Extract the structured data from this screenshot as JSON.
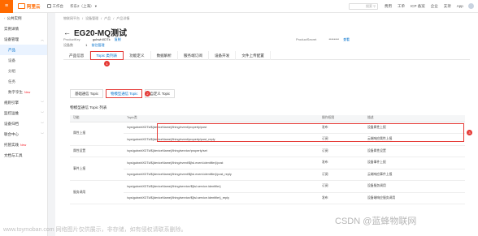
{
  "topbar": {
    "brand": "阿里云",
    "workbench": "工作台",
    "region": "华东2（上海）",
    "search_placeholder": "搜索",
    "links": [
      "费用",
      "工单",
      "ICP 备案",
      "企业",
      "支持",
      "App"
    ]
  },
  "sidebar": {
    "items": [
      {
        "label": "公共实例",
        "arrow": "‹"
      },
      {
        "label": "实例详情"
      },
      {
        "label": "设备管理",
        "arrow": "^"
      },
      {
        "label": "产品",
        "sub": true,
        "active": true
      },
      {
        "label": "设备",
        "sub": true
      },
      {
        "label": "分组",
        "sub": true
      },
      {
        "label": "任务",
        "sub": true
      },
      {
        "label": "数字孪生",
        "sub": true,
        "badge": "New"
      },
      {
        "label": "规则引擎",
        "arrow": "v"
      },
      {
        "label": "监控运维",
        "arrow": "v"
      },
      {
        "label": "设备归档",
        "arrow": "v"
      },
      {
        "label": "联合中心",
        "arrow": "v"
      },
      {
        "label": "托管实践",
        "badge": "New"
      },
      {
        "label": "文档与工具"
      }
    ]
  },
  "breadcrumb": [
    "物联网平台",
    "/",
    "设备管理",
    "/",
    "产品",
    "/",
    "产品详情"
  ],
  "page": {
    "title": "EG20-MQ测试",
    "product_key_label": "ProductKey",
    "product_key_value": "gubwhXDTk",
    "product_key_link": "复制",
    "product_secret_label": "ProductSecret",
    "product_secret_value": "********",
    "product_secret_link": "查看",
    "device_count_label": "设备数",
    "device_count_value": "1",
    "device_count_link": "前往管理"
  },
  "tabs": [
    {
      "label": "产品信息"
    },
    {
      "label": "Topic 类列表",
      "active": true
    },
    {
      "label": "功能定义"
    },
    {
      "label": "数据解析"
    },
    {
      "label": "服务端订阅"
    },
    {
      "label": "设备开发"
    },
    {
      "label": "文件上传配置"
    }
  ],
  "subtabs": [
    {
      "label": "基础通信 Topic"
    },
    {
      "label": "物模型通信 Topic",
      "active": true
    },
    {
      "label": "自定义 Topic"
    }
  ],
  "markers": [
    "1",
    "2",
    "3"
  ],
  "section_title": "物模型通信 Topic 列表",
  "table": {
    "headers": [
      "功能",
      "Topic类",
      "操作权限",
      "描述"
    ],
    "rows": [
      {
        "fn": "属性上报",
        "topic": "/sys/gubwhXDTk/${deviceName}/thing/event/property/post",
        "op": "发布",
        "desc": "设备属性上报"
      },
      {
        "fn": "",
        "topic": "/sys/gubwhXDTk/${deviceName}/thing/event/property/post_reply",
        "op": "订阅",
        "desc": "云端响应属性上报"
      },
      {
        "fn": "属性设置",
        "topic": "/sys/gubwhXDTk/${deviceName}/thing/service/property/set",
        "op": "订阅",
        "desc": "设备属性设置"
      },
      {
        "fn": "事件上报",
        "topic": "/sys/gubwhXDTk/${deviceName}/thing/event/${tsl.event.identifier}/post",
        "op": "发布",
        "desc": "设备事件上报"
      },
      {
        "fn": "",
        "topic": "/sys/gubwhXDTk/${deviceName}/thing/event/${tsl.event.identifier}/post_reply",
        "op": "订阅",
        "desc": "云端响应事件上报"
      },
      {
        "fn": "服务调用",
        "topic": "/sys/gubwhXDTk/${deviceName}/thing/service/${tsl.service.identifier}",
        "op": "订阅",
        "desc": "设备服务调用"
      },
      {
        "fn": "",
        "topic": "/sys/gubwhXDTk/${deviceName}/thing/service/${tsl.service.identifier}_reply",
        "op": "发布",
        "desc": "设备端响应服务调用"
      }
    ]
  },
  "watermark_left": "www.toymoban.com 网络图片仅供展示，非存储，如有侵权请联系删除。",
  "watermark_right": "CSDN @蓝蜂物联网",
  "colors": {
    "brand": "#ff6a00",
    "link": "#0070cc",
    "highlight": "#e53935"
  }
}
